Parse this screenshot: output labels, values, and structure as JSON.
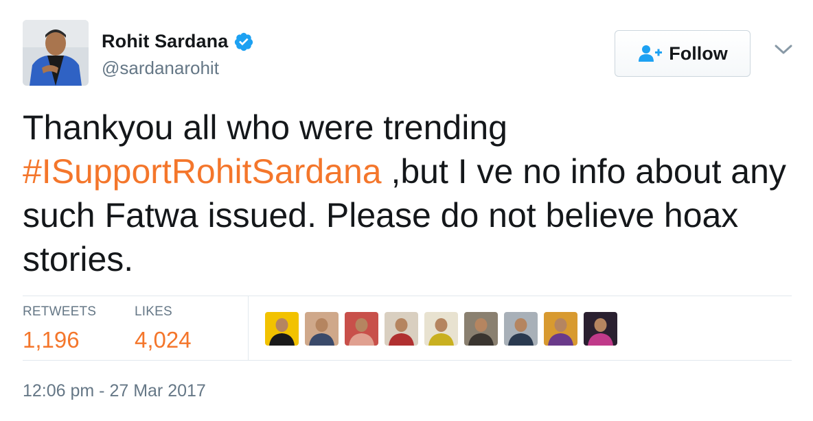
{
  "user": {
    "name": "Rohit Sardana",
    "handle": "@sardanarohit",
    "verified": true
  },
  "follow_button": {
    "label": "Follow",
    "icon": "add-user-icon"
  },
  "tweet": {
    "text_before": "Thankyou all who were trending ",
    "hashtag": "#ISupportRohitSardana",
    "text_after": " ,but I ve no info about any such Fatwa issued. Please do not believe hoax stories."
  },
  "stats": {
    "retweets_label": "RETWEETS",
    "retweets_value": "1,196",
    "likes_label": "LIKES",
    "likes_value": "4,024"
  },
  "likers": [
    {
      "bg": "#f2c200",
      "fg": "#1a1a1a"
    },
    {
      "bg": "#cfa88a",
      "fg": "#3a4a6a"
    },
    {
      "bg": "#c8504a",
      "fg": "#e0a090"
    },
    {
      "bg": "#d9cfc0",
      "fg": "#b03030"
    },
    {
      "bg": "#e8e2d0",
      "fg": "#c9b020"
    },
    {
      "bg": "#8a8070",
      "fg": "#3a3530"
    },
    {
      "bg": "#a8b0b8",
      "fg": "#2a3a50"
    },
    {
      "bg": "#d89a30",
      "fg": "#6a3a8a"
    },
    {
      "bg": "#2a2030",
      "fg": "#c03a8a"
    }
  ],
  "timestamp": "12:06 pm - 27 Mar 2017",
  "colors": {
    "accent": "#f4762b",
    "verified": "#1da1f2",
    "muted": "#657786",
    "follow_icon": "#1da1f2"
  }
}
